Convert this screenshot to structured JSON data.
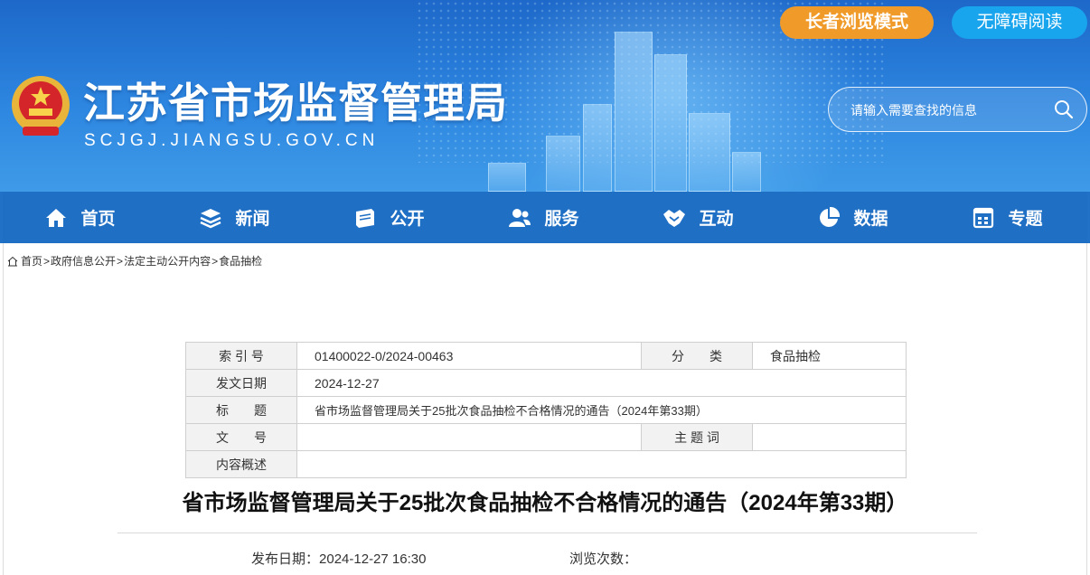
{
  "header": {
    "site_title": "江苏省市场监督管理局",
    "site_url": "SCJGJ.JIANGSU.GOV.CN",
    "elder_mode_label": "长者浏览模式",
    "accessibility_label": "无障碍阅读",
    "search_placeholder": "请输入需要查找的信息"
  },
  "nav": {
    "items": [
      {
        "label": "首页",
        "icon": "home-icon"
      },
      {
        "label": "新闻",
        "icon": "layers-icon"
      },
      {
        "label": "公开",
        "icon": "book-icon"
      },
      {
        "label": "服务",
        "icon": "people-icon"
      },
      {
        "label": "互动",
        "icon": "handshake-icon"
      },
      {
        "label": "数据",
        "icon": "pie-chart-icon"
      },
      {
        "label": "专题",
        "icon": "calendar-icon"
      }
    ]
  },
  "breadcrumb": {
    "items": [
      "首页",
      "政府信息公开",
      "法定主动公开内容",
      "食品抽检"
    ],
    "separator": ">"
  },
  "meta_table": {
    "index_label": "索 引 号",
    "index_value": "01400022-0/2024-00463",
    "category_label": "分　　类",
    "category_value": "食品抽检",
    "date_label": "发文日期",
    "date_value": "2024-12-27",
    "title_label": "标　　题",
    "title_value": "省市场监督管理局关于25批次食品抽检不合格情况的通告（2024年第33期）",
    "doc_no_label": "文　　号",
    "doc_no_value": "",
    "keywords_label": "主 题 词",
    "keywords_value": "",
    "summary_label": "内容概述",
    "summary_value": ""
  },
  "article": {
    "title": "省市场监督管理局关于25批次食品抽检不合格情况的通告（2024年第33期）",
    "publish_label": "发布日期：",
    "publish_value": "2024-12-27 16:30",
    "views_label": "浏览次数："
  },
  "colors": {
    "header_blue": "#2d86e0",
    "nav_blue": "#1f6fc5",
    "elder_orange": "#f09a2a",
    "access_blue": "#18a5ee"
  }
}
